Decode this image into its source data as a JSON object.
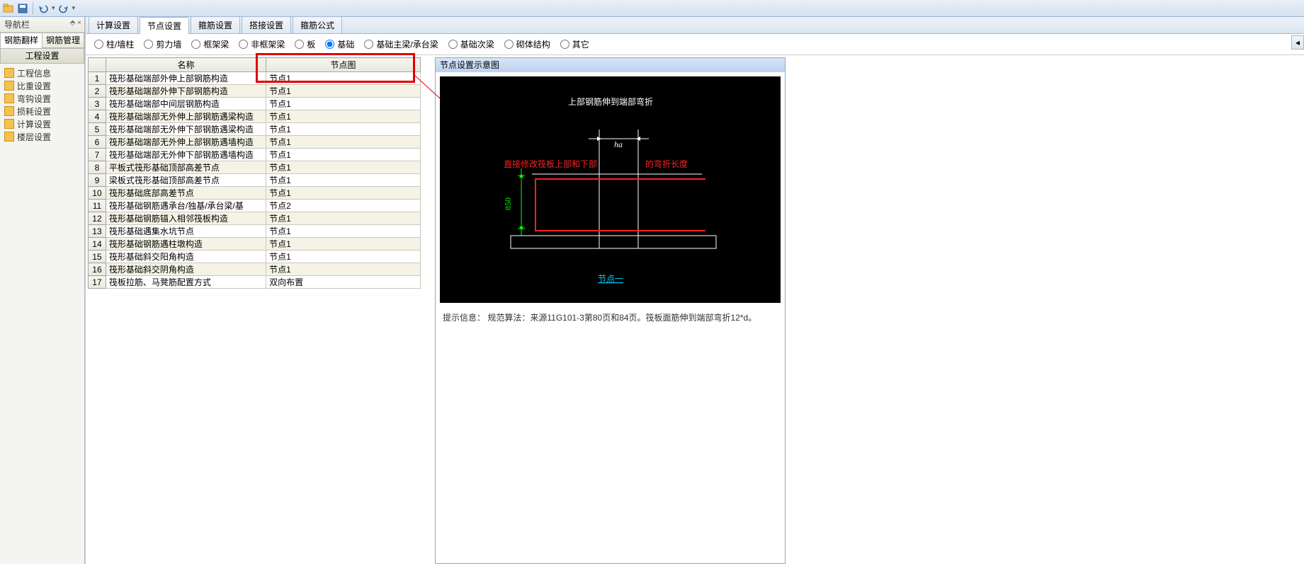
{
  "toolbar": {
    "nav_label": "导航栏",
    "pin": "⬘ ×"
  },
  "left": {
    "tabs": [
      "钢筋翻样",
      "钢筋管理"
    ],
    "section": "工程设置",
    "tree": [
      "工程信息",
      "比重设置",
      "弯钩设置",
      "损耗设置",
      "计算设置",
      "楼层设置"
    ]
  },
  "doc_tabs": [
    "计算设置",
    "节点设置",
    "箍筋设置",
    "搭接设置",
    "箍筋公式"
  ],
  "radios": [
    "柱/墙柱",
    "剪力墙",
    "框架梁",
    "非框架梁",
    "板",
    "基础",
    "基础主梁/承台梁",
    "基础次梁",
    "砌体结构",
    "其它"
  ],
  "radio_selected": 5,
  "grid": {
    "headers": [
      "",
      "名称",
      "节点图"
    ],
    "rows": [
      {
        "n": 1,
        "name": "筏形基础端部外伸上部钢筋构造",
        "node": "节点1"
      },
      {
        "n": 2,
        "name": "筏形基础端部外伸下部钢筋构造",
        "node": "节点1"
      },
      {
        "n": 3,
        "name": "筏形基础端部中间层钢筋构造",
        "node": "节点1"
      },
      {
        "n": 4,
        "name": "筏形基础端部无外伸上部钢筋遇梁构造",
        "node": "节点1"
      },
      {
        "n": 5,
        "name": "筏形基础端部无外伸下部钢筋遇梁构造",
        "node": "节点1"
      },
      {
        "n": 6,
        "name": "筏形基础端部无外伸上部钢筋遇墙构造",
        "node": "节点1"
      },
      {
        "n": 7,
        "name": "筏形基础端部无外伸下部钢筋遇墙构造",
        "node": "节点1"
      },
      {
        "n": 8,
        "name": "平板式筏形基础顶部高差节点",
        "node": "节点1"
      },
      {
        "n": 9,
        "name": "梁板式筏形基础顶部高差节点",
        "node": "节点1"
      },
      {
        "n": 10,
        "name": "筏形基础底部高差节点",
        "node": "节点1"
      },
      {
        "n": 11,
        "name": "筏形基础钢筋遇承台/独基/承台梁/基",
        "node": "节点2"
      },
      {
        "n": 12,
        "name": "筏形基础钢筋锚入相邻筏板构造",
        "node": "节点1"
      },
      {
        "n": 13,
        "name": "筏形基础遇集水坑节点",
        "node": "节点1"
      },
      {
        "n": 14,
        "name": "筏形基础钢筋遇柱墩构造",
        "node": "节点1"
      },
      {
        "n": 15,
        "name": "筏形基础斜交阳角构造",
        "node": "节点1"
      },
      {
        "n": 16,
        "name": "筏形基础斜交阴角构造",
        "node": "节点1"
      },
      {
        "n": 17,
        "name": "筏板拉筋、马凳筋配置方式",
        "node": "双向布置"
      }
    ]
  },
  "detail": {
    "title": "节点设置示意图",
    "canvas": {
      "heading": "上部钢筋伸到端部弯折",
      "anno": "直接修改筏板上部和下部",
      "anno2": "的弯折长度",
      "ha": "ha",
      "dim": "850",
      "node_label": "节点一"
    },
    "tip_label": "提示信息：",
    "tip": "规范算法：来源11G101-3第80页和84页。筏板面筋伸到端部弯折12*d。"
  }
}
